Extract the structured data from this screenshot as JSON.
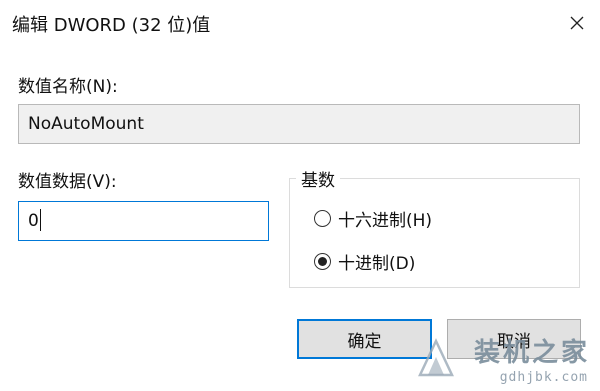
{
  "window": {
    "title": "编辑 DWORD (32 位)值",
    "close_icon": "close-icon"
  },
  "value_name": {
    "label": "数值名称(N):",
    "value": "NoAutoMount"
  },
  "value_data": {
    "label": "数值数据(V):",
    "value": "0"
  },
  "base": {
    "legend": "基数",
    "options": [
      {
        "label": "十六进制(H)",
        "selected": false
      },
      {
        "label": "十进制(D)",
        "selected": true
      }
    ]
  },
  "buttons": {
    "ok": "确定",
    "cancel": "取消"
  },
  "watermark": {
    "text": "装机之家",
    "url": "gdhjbk.com"
  },
  "colors": {
    "accent": "#0078d7",
    "readonly_field_bg": "#f0f0f0",
    "button_bg": "#e1e1e1"
  }
}
